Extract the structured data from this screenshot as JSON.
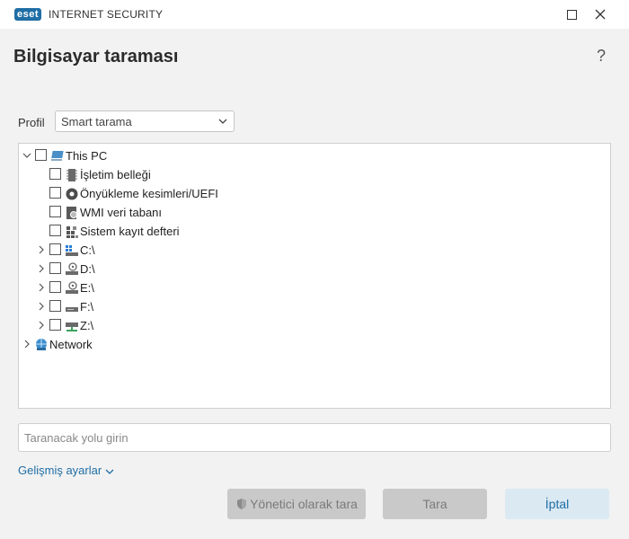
{
  "window": {
    "logo_text": "eset",
    "product_name": "INTERNET SECURITY",
    "minimize_icon": "minimize-icon",
    "close_icon": "close-icon"
  },
  "page": {
    "title": "Bilgisayar taraması",
    "help_label": "?"
  },
  "profile": {
    "label": "Profil",
    "selected": "Smart tarama"
  },
  "tree": {
    "root": {
      "label": "This PC",
      "expanded": true,
      "checked": false,
      "icon": "computer-icon"
    },
    "items": [
      {
        "label": "İşletim belleği",
        "icon": "memory-icon",
        "checked": false,
        "expandable": false
      },
      {
        "label": "Önyükleme kesimleri/UEFI",
        "icon": "boot-sector-icon",
        "checked": false,
        "expandable": false
      },
      {
        "label": "WMI veri tabanı",
        "icon": "wmi-database-icon",
        "checked": false,
        "expandable": false
      },
      {
        "label": "Sistem kayıt defteri",
        "icon": "registry-icon",
        "checked": false,
        "expandable": false
      },
      {
        "label": "C:\\",
        "icon": "windows-drive-icon",
        "checked": false,
        "expandable": true
      },
      {
        "label": "D:\\",
        "icon": "disc-drive-icon",
        "checked": false,
        "expandable": true
      },
      {
        "label": "E:\\",
        "icon": "disc-drive-icon",
        "checked": false,
        "expandable": true
      },
      {
        "label": "F:\\",
        "icon": "removable-drive-icon",
        "checked": false,
        "expandable": true
      },
      {
        "label": "Z:\\",
        "icon": "network-drive-icon",
        "checked": false,
        "expandable": true
      }
    ],
    "network": {
      "label": "Network",
      "icon": "network-icon",
      "expanded": false
    }
  },
  "path_input": {
    "placeholder": "Taranacak yolu girin",
    "value": ""
  },
  "advanced": {
    "label": "Gelişmiş ayarlar"
  },
  "buttons": {
    "admin_scan": "Yönetici olarak tara",
    "scan": "Tara",
    "cancel": "İptal"
  },
  "colors": {
    "accent": "#1f6ea5",
    "disabled_button": "#c9c9c9",
    "cancel_button": "#dbe9f3"
  }
}
